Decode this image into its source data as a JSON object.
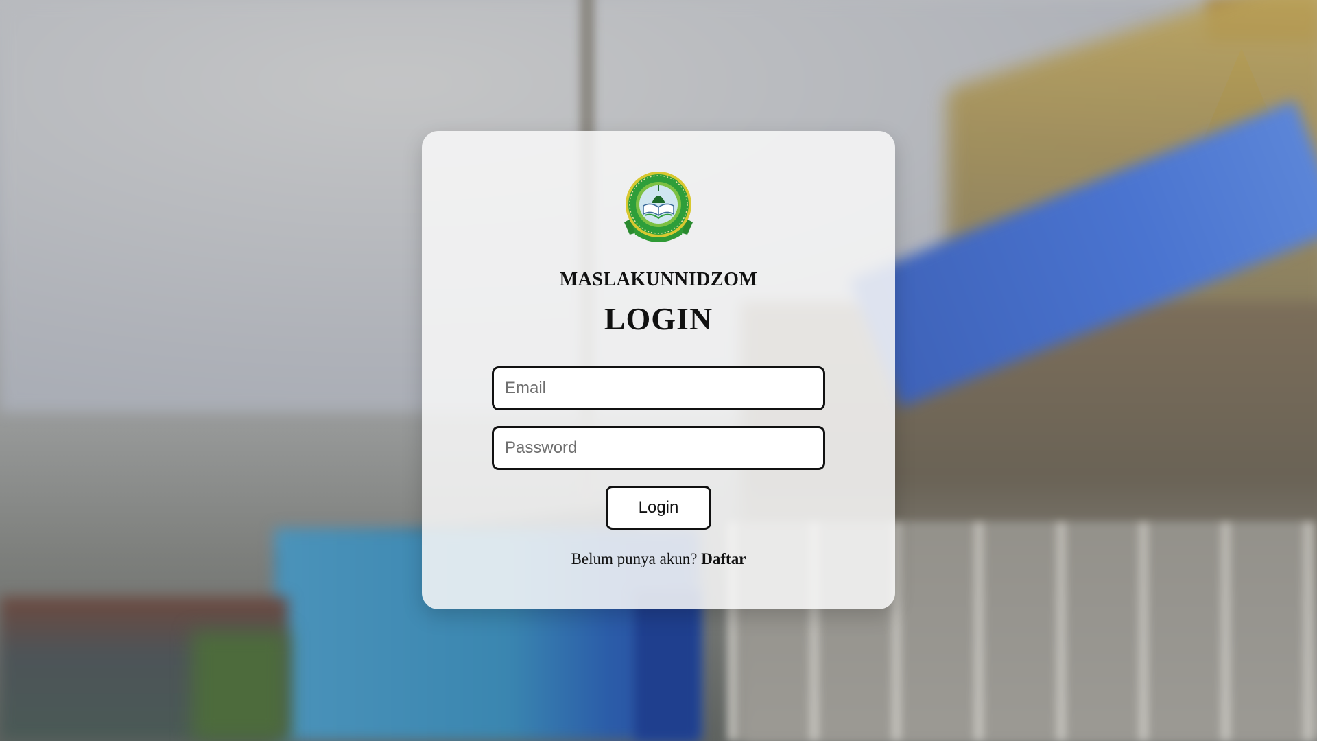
{
  "login": {
    "brand": "MASLAKUNNIDZOM",
    "heading": "LOGIN",
    "email_placeholder": "Email",
    "password_placeholder": "Password",
    "button_label": "Login",
    "signup_prompt": "Belum punya akun?",
    "signup_link": "Daftar"
  },
  "colors": {
    "card_background": "#f5f5f5",
    "border": "#111111",
    "logo_green": "#2e9e3a",
    "logo_yellow": "#d6c22a"
  },
  "icons": {
    "logo": "school-emblem-icon"
  }
}
